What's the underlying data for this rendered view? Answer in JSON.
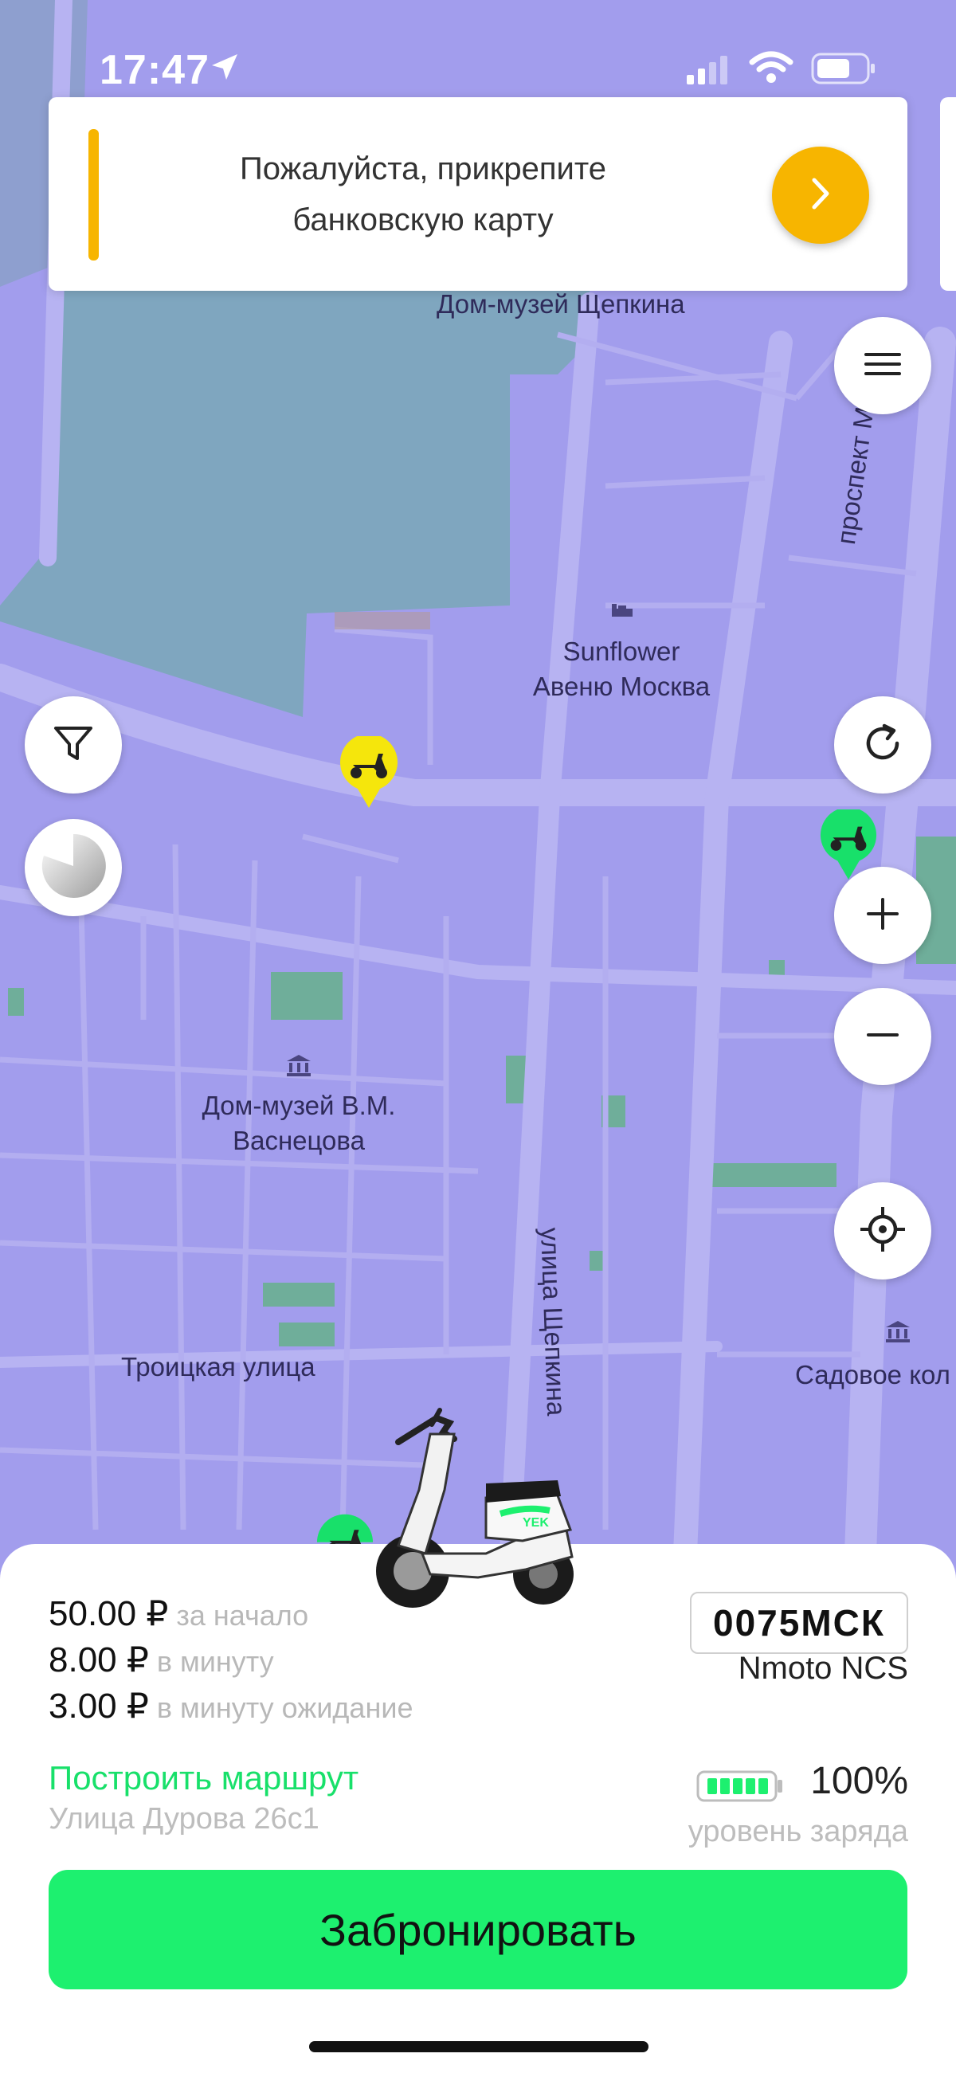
{
  "status_bar": {
    "time": "17:47"
  },
  "banner": {
    "line1": "Пожалуйста, прикрепите",
    "line2": "банковскую карту"
  },
  "map_labels": {
    "museum_shchepkin": "Дом-музей Щепкина",
    "prospekt_mira": "проспект Мира",
    "hotel_line1": "Sunflower",
    "hotel_line2": "Авеню Москва",
    "museum_vasnetsov_line1": "Дом-музей В.М.",
    "museum_vasnetsov_line2": "Васнецова",
    "troitskaya": "Троицкая улица",
    "shchepkina_street": "улица Щепкина",
    "sadovoe": "Садовое кол"
  },
  "vehicle": {
    "plate": "0075МСК",
    "model": "Nmoto NCS",
    "battery_percent": "100%",
    "battery_label": "уровень заряда",
    "battery_level": 1.0
  },
  "pricing": [
    {
      "amount": "50.00 ₽",
      "desc": "за начало"
    },
    {
      "amount": "8.00 ₽",
      "desc": "в минуту"
    },
    {
      "amount": "3.00 ₽",
      "desc": "в минуту ожидание"
    }
  ],
  "route": {
    "label": "Построить маршрут",
    "address": "Улица Дурова 26с1"
  },
  "book_button": "Забронировать",
  "colors": {
    "map_bg": "#a29ded",
    "accent_yellow": "#f7b500",
    "accent_green": "#1df06f",
    "route_green": "#18e06a"
  },
  "icons": [
    "location-arrow-icon",
    "signal-icon",
    "wifi-icon",
    "battery-icon",
    "chevron-right-icon",
    "menu-icon",
    "filter-icon",
    "pie-icon",
    "refresh-icon",
    "plus-icon",
    "minus-icon",
    "crosshair-icon",
    "scooter-icon",
    "museum-icon",
    "hotel-icon"
  ]
}
